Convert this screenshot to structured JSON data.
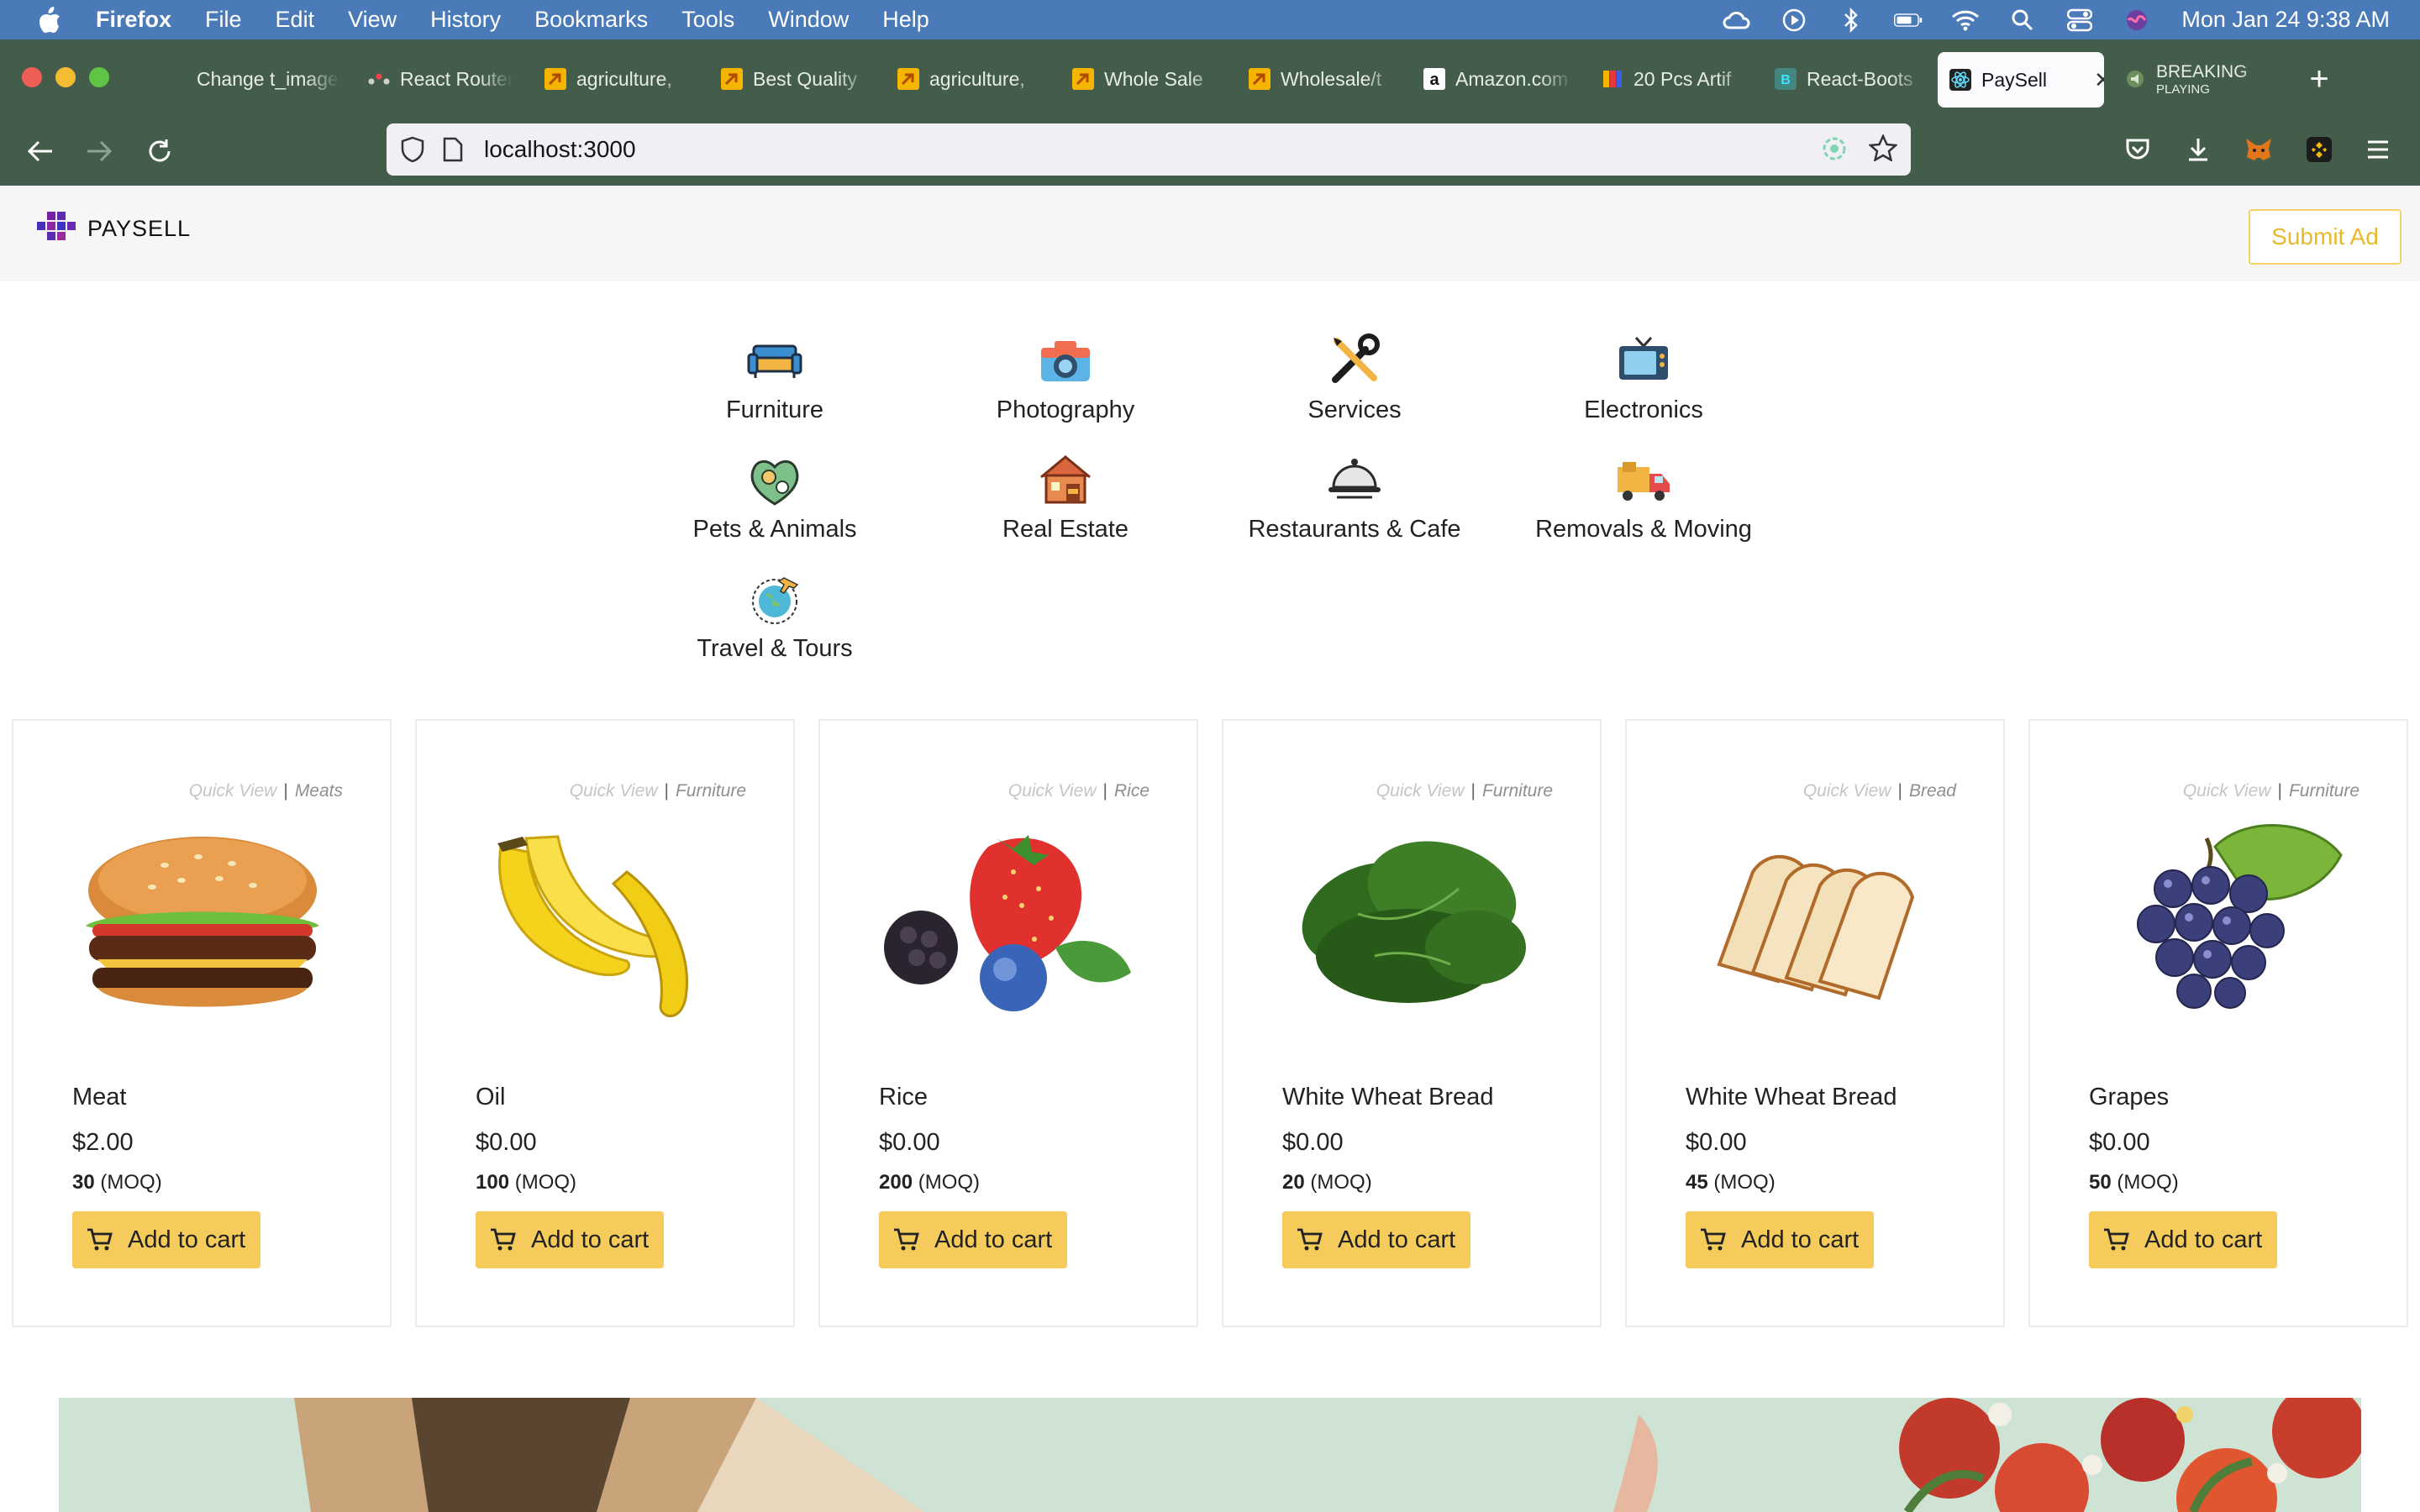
{
  "menubar": {
    "app_name": "Firefox",
    "items": [
      "File",
      "Edit",
      "View",
      "History",
      "Bookmarks",
      "Tools",
      "Window",
      "Help"
    ],
    "clock": "Mon Jan 24  9:38 AM"
  },
  "browser": {
    "tabs": [
      {
        "label": "Change t_image",
        "icon": "page-icon"
      },
      {
        "label": "React Router",
        "icon": "react-router-icon"
      },
      {
        "label": "agriculture,",
        "icon": "alibaba-icon"
      },
      {
        "label": "Best Quality",
        "icon": "alibaba-icon"
      },
      {
        "label": "agriculture,",
        "icon": "alibaba-icon"
      },
      {
        "label": "Whole Sale",
        "icon": "alibaba-icon"
      },
      {
        "label": "Wholesale/t",
        "icon": "alibaba-icon"
      },
      {
        "label": "Amazon.com",
        "icon": "amazon-icon"
      },
      {
        "label": "20 Pcs Artif",
        "icon": "shop-icon"
      },
      {
        "label": "React-Boots",
        "icon": "bootstrap-icon"
      },
      {
        "label": "PaySell",
        "icon": "react-icon",
        "active": true
      },
      {
        "label": "BREAKING",
        "sublabel": "PLAYING",
        "icon": "audio-icon"
      }
    ],
    "url": "localhost:3000"
  },
  "header": {
    "logo_text": "PAYSELL",
    "submit_label": "Submit Ad"
  },
  "categories": [
    {
      "label": "Furniture",
      "icon": "sofa-icon"
    },
    {
      "label": "Photography",
      "icon": "camera-icon"
    },
    {
      "label": "Services",
      "icon": "tools-icon"
    },
    {
      "label": "Electronics",
      "icon": "tv-icon"
    },
    {
      "label": "Pets & Animals",
      "icon": "pets-icon"
    },
    {
      "label": "Real Estate",
      "icon": "house-icon"
    },
    {
      "label": "Restaurants & Cafe",
      "icon": "cloche-icon"
    },
    {
      "label": "Removals & Moving",
      "icon": "truck-icon"
    },
    {
      "label": "Travel & Tours",
      "icon": "globe-plane-icon"
    }
  ],
  "products": {
    "quick_view_label": "Quick View",
    "moq_suffix": "(MOQ)",
    "add_to_cart_label": "Add to cart",
    "items": [
      {
        "name": "Meat",
        "price": "$2.00",
        "moq": "30",
        "category": "Meats",
        "image": "burger"
      },
      {
        "name": "Oil",
        "price": "$0.00",
        "moq": "100",
        "category": "Furniture",
        "image": "bananas"
      },
      {
        "name": "Rice",
        "price": "$0.00",
        "moq": "200",
        "category": "Rice",
        "image": "berries"
      },
      {
        "name": "White Wheat Bread",
        "price": "$0.00",
        "moq": "20",
        "category": "Furniture",
        "image": "spinach"
      },
      {
        "name": "White Wheat Bread",
        "price": "$0.00",
        "moq": "45",
        "category": "Bread",
        "image": "bread"
      },
      {
        "name": "Grapes",
        "price": "$0.00",
        "moq": "50",
        "category": "Furniture",
        "image": "grapes"
      }
    ]
  },
  "banner": {
    "image": "gift-box-flowers"
  }
}
